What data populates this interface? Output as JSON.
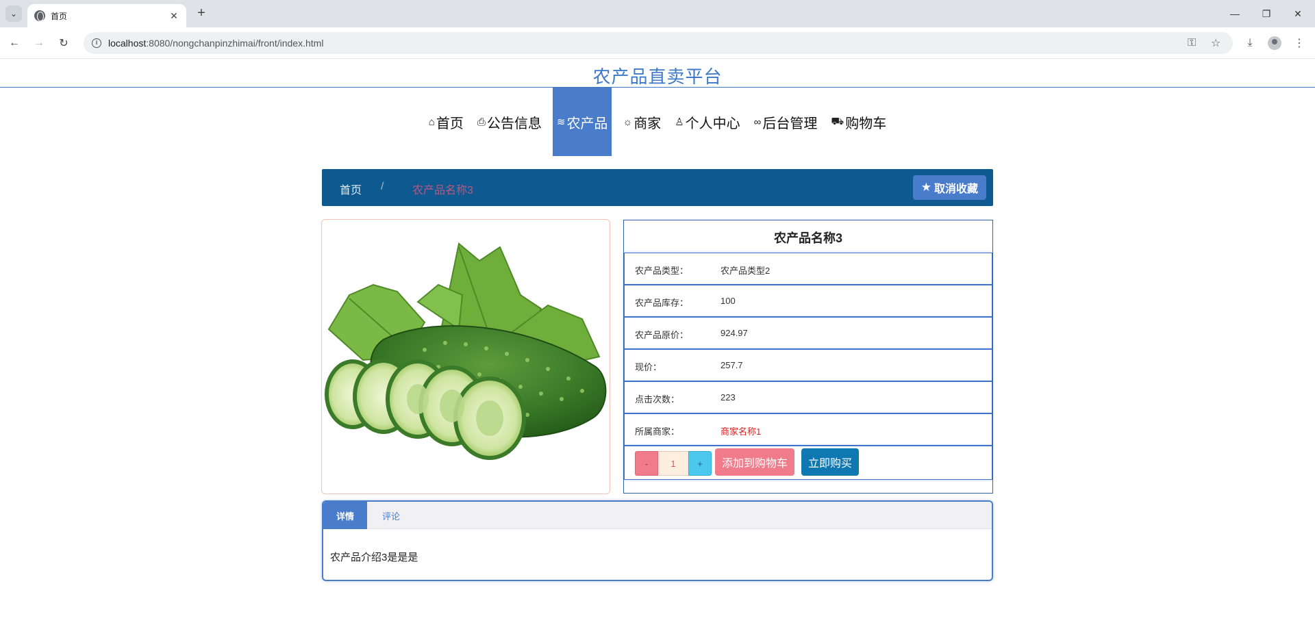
{
  "browser": {
    "tab_title": "首页",
    "url_host": "localhost",
    "url_rest": ":8080/nongchanpinzhimai/front/index.html"
  },
  "site": {
    "title": "农产品直卖平台"
  },
  "nav": [
    {
      "label": "首页",
      "icon": "home-icon",
      "active": false
    },
    {
      "label": "公告信息",
      "icon": "announcement-icon",
      "active": false
    },
    {
      "label": "农产品",
      "icon": "layers-icon",
      "active": true
    },
    {
      "label": "商家",
      "icon": "sun-icon",
      "active": false
    },
    {
      "label": "个人中心",
      "icon": "user-icon",
      "active": false
    },
    {
      "label": "后台管理",
      "icon": "link-icon",
      "active": false
    },
    {
      "label": "购物车",
      "icon": "cart-icon",
      "active": false
    }
  ],
  "breadcrumb": {
    "home": "首页",
    "separator": "/",
    "current": "农产品名称3"
  },
  "favorite_button": {
    "label": "取消收藏",
    "icon": "star-icon"
  },
  "product": {
    "image_alt": "cucumber",
    "name": "农产品名称3",
    "rows": [
      {
        "label": "农产品类型：",
        "value": "农产品类型2",
        "highlight": false
      },
      {
        "label": "农产品库存：",
        "value": "100",
        "highlight": false
      },
      {
        "label": "农产品原价：",
        "value": "924.97",
        "highlight": false
      },
      {
        "label": "现价：",
        "value": "257.7",
        "highlight": false
      },
      {
        "label": "点击次数：",
        "value": "223",
        "highlight": false
      },
      {
        "label": "所属商家：",
        "value": "商家名称1",
        "highlight": true
      }
    ],
    "quantity": {
      "minus": "-",
      "value": "1",
      "plus": "+"
    },
    "add_to_cart": "添加到购物车",
    "buy_now": "立即购买"
  },
  "detail_tabs": {
    "tabs": [
      "详情",
      "评论"
    ],
    "active": 0,
    "content": "农产品介绍3是是是"
  },
  "colors": {
    "accent": "#4a7ccc",
    "breadcrumb_bg": "#0e5a90",
    "danger_pink": "#f07b8a",
    "buy_blue": "#0f78b0"
  }
}
